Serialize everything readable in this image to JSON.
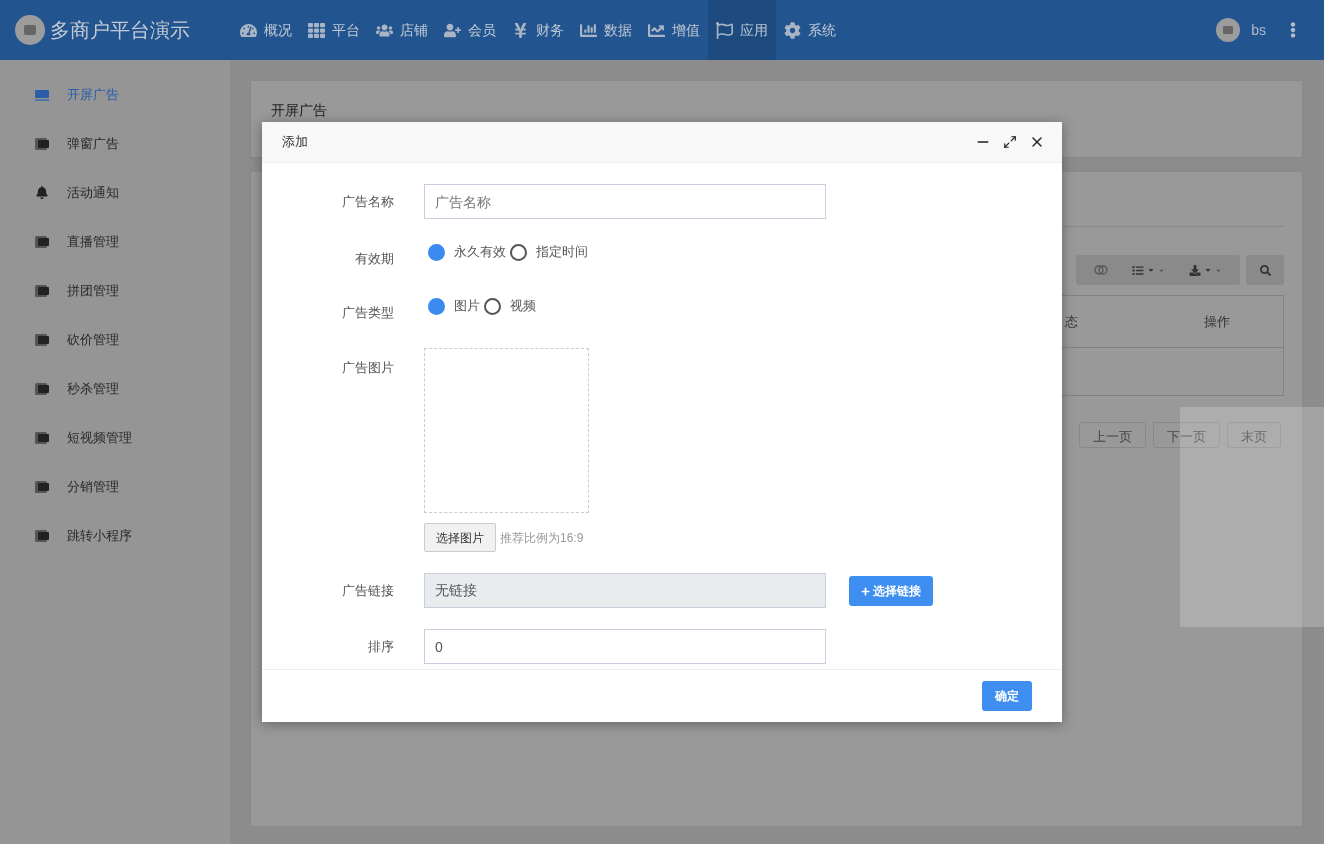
{
  "topbar": {
    "brand": "多商户平台演示",
    "user": "bs",
    "menu": [
      {
        "label": "概况",
        "selected": false
      },
      {
        "label": "平台",
        "selected": false
      },
      {
        "label": "店铺",
        "selected": false
      },
      {
        "label": "会员",
        "selected": false
      },
      {
        "label": "财务",
        "selected": false
      },
      {
        "label": "数据",
        "selected": false
      },
      {
        "label": "增值",
        "selected": false
      },
      {
        "label": "应用",
        "selected": true
      },
      {
        "label": "系统",
        "selected": false
      }
    ]
  },
  "sidebar": {
    "items": [
      {
        "label": "开屏广告",
        "kind": "ad",
        "selected": true
      },
      {
        "label": "弹窗广告",
        "kind": "ad",
        "selected": false
      },
      {
        "label": "活动通知",
        "kind": "bell",
        "selected": false
      },
      {
        "label": "直播管理",
        "kind": "ad",
        "selected": false
      },
      {
        "label": "拼团管理",
        "kind": "ad",
        "selected": false
      },
      {
        "label": "砍价管理",
        "kind": "ad",
        "selected": false
      },
      {
        "label": "秒杀管理",
        "kind": "ad",
        "selected": false
      },
      {
        "label": "短视频管理",
        "kind": "ad",
        "selected": false
      },
      {
        "label": "分销管理",
        "kind": "ad",
        "selected": false
      },
      {
        "label": "跳转小程序",
        "kind": "ad",
        "selected": false
      }
    ]
  },
  "page": {
    "title": "开屏广告",
    "table": {
      "columns": [
        "态",
        "操作"
      ]
    },
    "pagination": [
      "上一页",
      "下一页",
      "末页"
    ]
  },
  "dialog": {
    "title": "添加",
    "fields": [
      {
        "kind": "text",
        "label": "广告名称",
        "placeholder": "广告名称"
      },
      {
        "kind": "radio",
        "label": "有效期",
        "options": [
          {
            "label": "永久有效",
            "selected": true
          },
          {
            "label": "指定时间",
            "selected": false
          }
        ]
      },
      {
        "kind": "radio",
        "label": "广告类型",
        "options": [
          {
            "label": "图片",
            "selected": true
          },
          {
            "label": "视频",
            "selected": false
          }
        ]
      },
      {
        "kind": "image",
        "label": "广告图片",
        "button": "选择图片",
        "hint": "推荐比例为16:9"
      },
      {
        "kind": "link",
        "label": "广告链接",
        "value": "无链接",
        "disabled": true,
        "button": "选择链接"
      },
      {
        "kind": "text",
        "label": "排序",
        "value": "0"
      }
    ],
    "confirm": "确定"
  }
}
